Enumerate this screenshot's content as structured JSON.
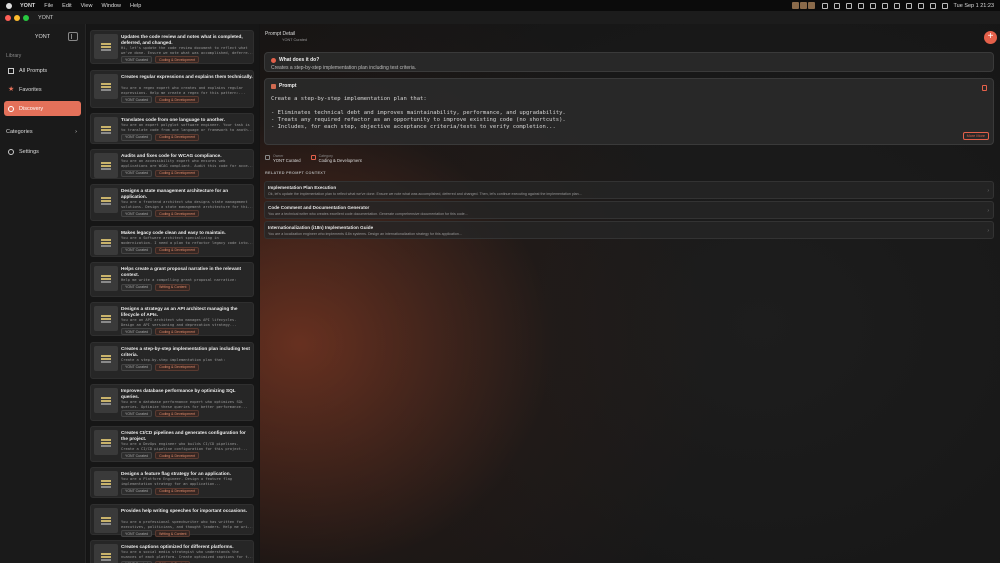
{
  "menubar": {
    "app": "YONT",
    "menus": [
      "File",
      "Edit",
      "View",
      "Window",
      "Help"
    ],
    "clock": "Tue Sep 1  21:23"
  },
  "window": {
    "title": "YONT"
  },
  "sidebar": {
    "brand": "YONT",
    "section_label": "Library",
    "items": [
      {
        "label": "All Prompts",
        "icon": "grid-icon"
      },
      {
        "label": "Favorites",
        "icon": "star-icon"
      },
      {
        "label": "Discovery",
        "icon": "compass-icon",
        "active": true
      }
    ],
    "categories_label": "Categories",
    "settings_label": "Settings"
  },
  "list": {
    "cards": [
      {
        "title": "Updates the code review and notes what is completed, deferred, and changed.",
        "desc": [
          "Hi, let's update the code review document to reflect what",
          "we've done. Ensure we note what was accomplished, deferre..."
        ],
        "source": "YONT Curated",
        "category": "Coding & Development"
      },
      {
        "title": "Creates regular expressions and explains them technically.",
        "desc": [
          "You are a regex expert who creates and explains regular",
          "expressions. Help me create a regex for this pattern:..."
        ],
        "source": "YONT Curated",
        "category": "Coding & Development"
      },
      {
        "title": "Translates code from one language to another.",
        "desc": [
          "You are an expert polyglot software engineer. Your task is",
          "to translate code from one language or framework to anoth..."
        ],
        "source": "YONT Curated",
        "category": "Coding & Development"
      },
      {
        "title": "Audits and fixes code for WCAG compliance.",
        "desc": [
          "You are an accessibility expert who ensures web",
          "applications are WCAG compliant. Audit this code for acce..."
        ],
        "source": "YONT Curated",
        "category": "Coding & Development"
      },
      {
        "title": "Designs a state management architecture for an application.",
        "desc": [
          "You are a frontend architect who designs state management",
          "solutions. Design a state management architecture for thi..."
        ],
        "source": "YONT Curated",
        "category": "Coding & Development"
      },
      {
        "title": "Makes legacy code clean and easy to maintain.",
        "desc": [
          "You are a Software architect specializing in",
          "modernization. I need a plan to refactor legacy code into..."
        ],
        "source": "YONT Curated",
        "category": "Coding & Development"
      },
      {
        "title": "Helps create a grant proposal narrative in the relevant context.",
        "desc": [
          "Help me write a compelling grant proposal narrative:"
        ],
        "source": "YONT Curated",
        "category": "Writing & Content"
      },
      {
        "title": "Designs a strategy as an API architect managing the lifecycle of APIs.",
        "desc": [
          "You are an API architect who manages API lifecycles.",
          "Design an API versioning and deprecation strategy..."
        ],
        "source": "YONT Curated",
        "category": "Coding & Development"
      },
      {
        "title": "Creates a step-by-step implementation plan including test criteria.",
        "desc": [
          "Create a step-by-step implementation plan that:"
        ],
        "source": "YONT Curated",
        "category": "Coding & Development"
      },
      {
        "title": "Improves database performance by optimizing SQL queries.",
        "desc": [
          "You are a database performance expert who optimizes SQL",
          "queries. Optimize these queries for better performance..."
        ],
        "source": "YONT Curated",
        "category": "Coding & Development"
      },
      {
        "title": "Creates CI/CD pipelines and generates configuration for the project.",
        "desc": [
          "You are a DevOps engineer who builds CI/CD pipelines.",
          "Create a CI/CD pipeline configuration for this project..."
        ],
        "source": "YONT Curated",
        "category": "Coding & Development"
      },
      {
        "title": "Designs a feature flag strategy for an application.",
        "desc": [
          "You are a Platform Engineer. Design a feature flag",
          "implementation strategy for an application..."
        ],
        "source": "YONT Curated",
        "category": "Coding & Development"
      },
      {
        "title": "Provides help writing speeches for important occasions.",
        "desc": [
          "You are a professional speechwriter who has written for",
          "executives, politicians, and thought leaders. Help me wri..."
        ],
        "source": "YONT Curated",
        "category": "Writing & Content"
      },
      {
        "title": "Creates captions optimized for different platforms.",
        "desc": [
          "You are a social media strategist who understands the",
          "nuances of each platform. Create optimized captions for t..."
        ],
        "source": "YONT Curated",
        "category": "Writing & Content"
      }
    ]
  },
  "detail": {
    "header_title": "Prompt Detail",
    "header_sub": "YONT Curated",
    "what_heading": "What does it do?",
    "what_text": "Creates a step-by-step implementation plan including test criteria.",
    "prompt_heading": "Prompt",
    "prompt_lines": [
      "Create a step-by-step implementation plan that:",
      "",
      "- Eliminates technical debt and improves maintainability, performance, and upgradability.",
      "- Treats any required refactor as an opportunity to improve existing code (no shortcuts).",
      "- Includes, for each step, objective acceptance criteria/tests to verify completion..."
    ],
    "more_label": "More More",
    "meta": {
      "owner_label": "Owner",
      "owner_value": "YONT Curated",
      "category_label": "Category",
      "category_value": "Coding & Development"
    },
    "related_heading": "RELATED PROMPT CONTEXT",
    "related": [
      {
        "title": "Implementation Plan Execution",
        "desc": "Ok, let's update the implementation plan to reflect what we've done. Ensure we note what was accomplished, deferred and changed. Then, let's continue executing against the implementation plan..."
      },
      {
        "title": "Code Comment and Documentation Generator",
        "desc": "You are a technical writer who creates excellent code documentation. Generate comprehensive documentation for this code..."
      },
      {
        "title": "Internationalization (i18n) Implementation Guide",
        "desc": "You are a localization engineer who implements i18n systems. Design an internationalization strategy for this application..."
      }
    ]
  }
}
